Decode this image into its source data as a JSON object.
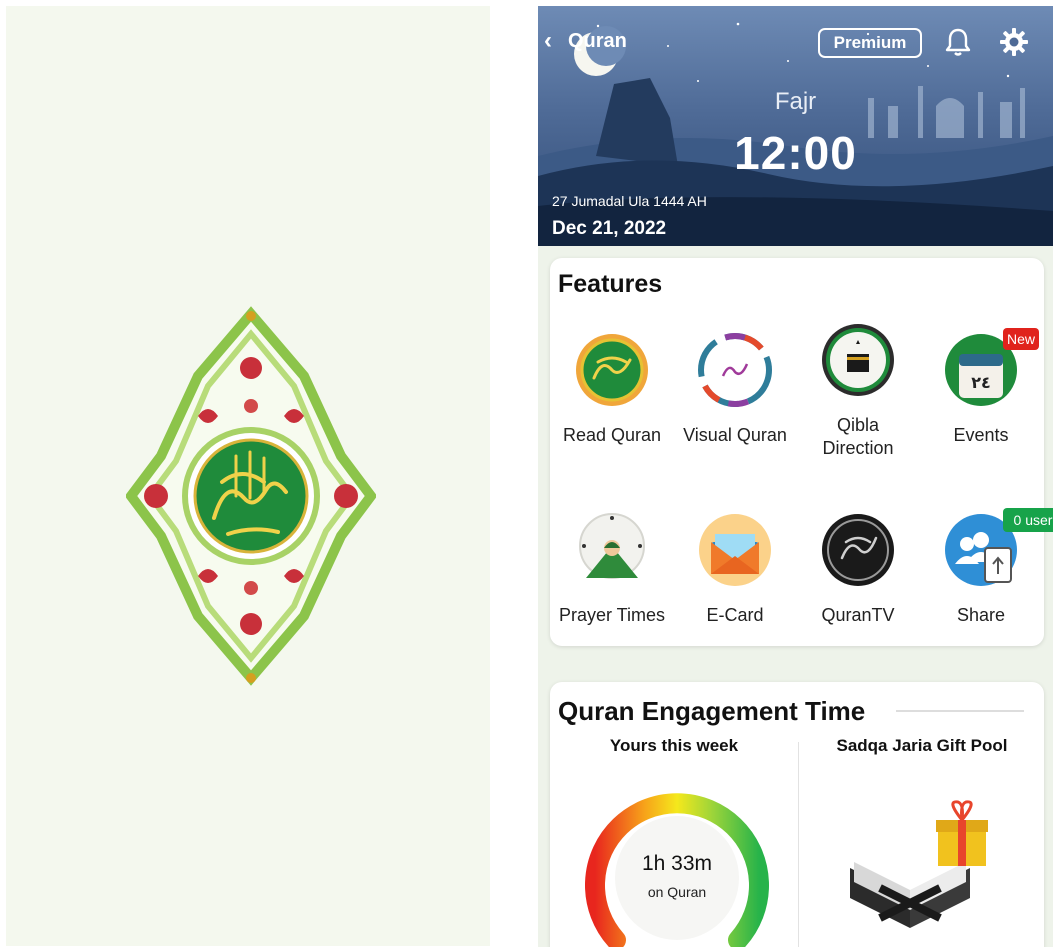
{
  "header": {
    "back_icon": "chevron-left-icon",
    "title": "Quran",
    "premium_label": "Premium",
    "bell_icon": "bell-icon",
    "settings_icon": "gear-icon",
    "prayer_name": "Fajr",
    "prayer_time": "12:00",
    "hijri_date": "27 Jumadal Ula 1444 AH",
    "gregorian_date": "Dec 21, 2022"
  },
  "features": {
    "title": "Features",
    "items": [
      {
        "label": "Read Quran",
        "icon": "quran-seal-icon"
      },
      {
        "label": "Visual Quran",
        "icon": "visual-quran-icon"
      },
      {
        "label": "Qibla Direction",
        "icon": "kaaba-icon"
      },
      {
        "label": "Events",
        "icon": "calendar-icon",
        "badge": "New"
      },
      {
        "label": "Prayer Times",
        "icon": "prayer-clock-icon"
      },
      {
        "label": "E-Card",
        "icon": "envelope-icon"
      },
      {
        "label": "QuranTV",
        "icon": "quran-tv-icon"
      },
      {
        "label": "Share",
        "icon": "share-users-icon",
        "badge": "0 user"
      }
    ],
    "events_calendar_text": "٢٤"
  },
  "engagement": {
    "title": "Quran Engagement Time",
    "left_column_title": "Yours this week",
    "right_column_title": "Sadqa Jaria Gift Pool",
    "gauge_value": "1h 33m",
    "gauge_unit": "on Quran",
    "gauge_colors": [
      "#e8261e",
      "#f7a21a",
      "#f5e81c",
      "#9bd43a",
      "#27b34a"
    ]
  },
  "colors": {
    "splash_bg": "#f4f8ee",
    "app_bg": "#eef3ea",
    "quran_green": "#1b8a3a",
    "gold": "#e6c233",
    "badge_red": "#e0231c",
    "badge_green": "#17a34a"
  }
}
